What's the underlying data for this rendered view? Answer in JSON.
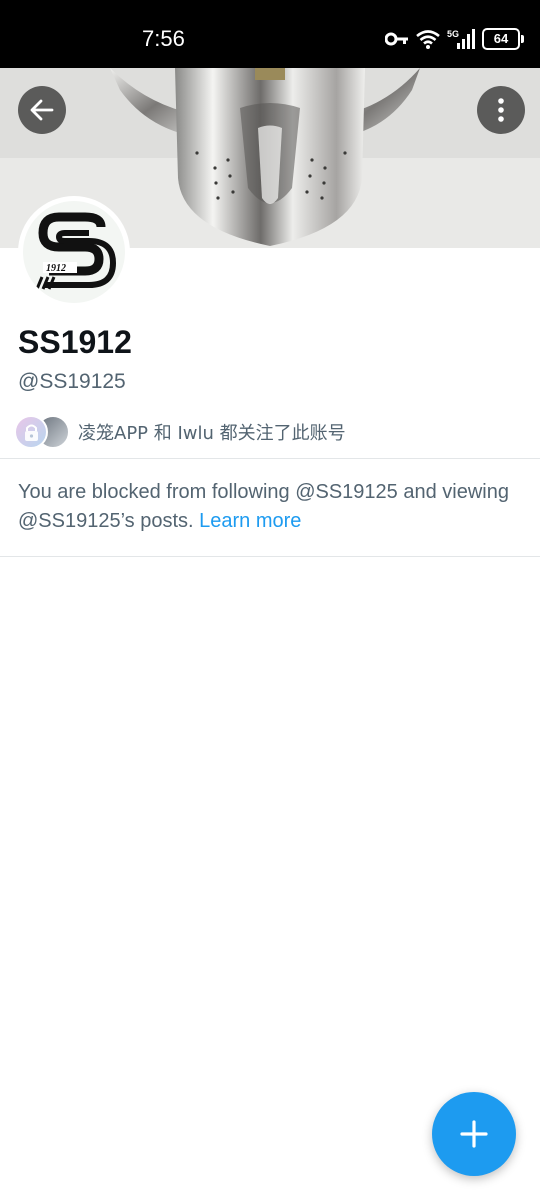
{
  "status_bar": {
    "time": "7:56",
    "icons": [
      "key-icon",
      "wifi-icon",
      "signal-5g-icon"
    ],
    "network": "5G",
    "battery": "64"
  },
  "header": {
    "back_icon": "arrow-left-icon",
    "more_icon": "more-vertical-icon"
  },
  "profile": {
    "logo_text": "1912",
    "display_name": "SS1912",
    "handle": "@SS19125",
    "followed_by": "凌笼APP 和 Iwlu 都关注了此账号"
  },
  "blocked": {
    "message": "You are blocked from following @SS19125 and viewing @SS19125’s posts. ",
    "link": "Learn more"
  },
  "fab": {
    "icon": "plus-icon"
  },
  "colors": {
    "accent": "#1d9bf0",
    "secondary_text": "#536471"
  }
}
